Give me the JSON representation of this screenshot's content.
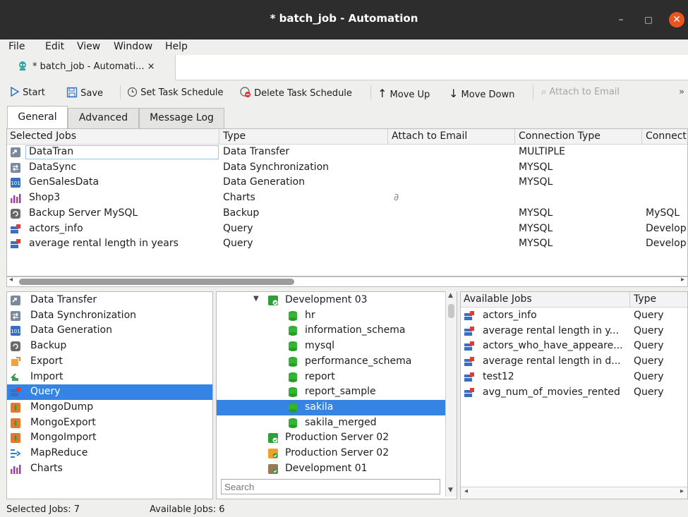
{
  "window": {
    "title": "* batch_job - Automation"
  },
  "menu": [
    "File",
    "Edit",
    "View",
    "Window",
    "Help"
  ],
  "doc_tab": {
    "label": "* batch_job - Automati... ×"
  },
  "toolbar": {
    "start": "Start",
    "save": "Save",
    "set_schedule": "Set Task Schedule",
    "delete_schedule": "Delete Task Schedule",
    "move_up": "Move Up",
    "move_down": "Move Down",
    "attach_email": "Attach to Email",
    "overflow": "»"
  },
  "tabs": [
    "General",
    "Advanced",
    "Message Log"
  ],
  "jobs_table": {
    "headers": [
      "Selected Jobs",
      "Type",
      "Attach to Email",
      "Connection Type",
      "Connecti"
    ],
    "rows": [
      {
        "icon": "data-transfer-icon",
        "name": "DataTran",
        "type": "Data Transfer",
        "attach": "",
        "conn_type": "MULTIPLE",
        "conn": ""
      },
      {
        "icon": "data-sync-icon",
        "name": "DataSync",
        "type": "Data Synchronization",
        "attach": "",
        "conn_type": "MYSQL",
        "conn": ""
      },
      {
        "icon": "data-generation-icon",
        "name": "GenSalesData",
        "type": "Data Generation",
        "attach": "",
        "conn_type": "MYSQL",
        "conn": ""
      },
      {
        "icon": "charts-icon",
        "name": "Shop3",
        "type": "Charts",
        "attach": "paperclip",
        "conn_type": "",
        "conn": ""
      },
      {
        "icon": "backup-icon",
        "name": "Backup Server MySQL",
        "type": "Backup",
        "attach": "",
        "conn_type": "MYSQL",
        "conn": "MySQL"
      },
      {
        "icon": "query-icon",
        "name": "actors_info",
        "type": "Query",
        "attach": "",
        "conn_type": "MYSQL",
        "conn": "Develop"
      },
      {
        "icon": "query-icon",
        "name": "average rental length in years",
        "type": "Query",
        "attach": "",
        "conn_type": "MYSQL",
        "conn": "Develop"
      }
    ]
  },
  "job_types": [
    {
      "label": "Data Transfer",
      "icon": "data-transfer-icon"
    },
    {
      "label": "Data Synchronization",
      "icon": "data-sync-icon"
    },
    {
      "label": "Data Generation",
      "icon": "data-generation-icon"
    },
    {
      "label": "Backup",
      "icon": "backup-icon"
    },
    {
      "label": "Export",
      "icon": "export-icon"
    },
    {
      "label": "Import",
      "icon": "import-icon"
    },
    {
      "label": "Query",
      "icon": "query-icon",
      "selected": true
    },
    {
      "label": "MongoDump",
      "icon": "mongodump-icon"
    },
    {
      "label": "MongoExport",
      "icon": "mongoexport-icon"
    },
    {
      "label": "MongoImport",
      "icon": "mongoimport-icon"
    },
    {
      "label": "MapReduce",
      "icon": "mapreduce-icon"
    },
    {
      "label": "Charts",
      "icon": "charts-icon"
    }
  ],
  "connections_tree": [
    {
      "label": "Development 03",
      "level": 0,
      "kind": "server-green",
      "expanded": true
    },
    {
      "label": "hr",
      "level": 1,
      "kind": "database"
    },
    {
      "label": "information_schema",
      "level": 1,
      "kind": "database"
    },
    {
      "label": "mysql",
      "level": 1,
      "kind": "database"
    },
    {
      "label": "performance_schema",
      "level": 1,
      "kind": "database"
    },
    {
      "label": "report",
      "level": 1,
      "kind": "database"
    },
    {
      "label": "report_sample",
      "level": 1,
      "kind": "database"
    },
    {
      "label": "sakila",
      "level": 1,
      "kind": "database",
      "selected": true
    },
    {
      "label": "sakila_merged",
      "level": 1,
      "kind": "database"
    },
    {
      "label": "Production Server 02",
      "level": 0,
      "kind": "server-green"
    },
    {
      "label": "Production Server 02",
      "level": 0,
      "kind": "server-orange"
    },
    {
      "label": "Development 01",
      "level": 0,
      "kind": "server-brown"
    }
  ],
  "search": {
    "placeholder": "Search"
  },
  "available_jobs": {
    "headers": [
      "Available Jobs",
      "Type"
    ],
    "rows": [
      {
        "name": "actors_info",
        "type": "Query"
      },
      {
        "name": "average rental length in y...",
        "type": "Query"
      },
      {
        "name": "actors_who_have_appeare...",
        "type": "Query"
      },
      {
        "name": "average rental length in d...",
        "type": "Query"
      },
      {
        "name": "test12",
        "type": "Query"
      },
      {
        "name": "avg_num_of_movies_rented",
        "type": "Query"
      }
    ]
  },
  "status": {
    "selected": "Selected Jobs: 7",
    "available": "Available Jobs: 6"
  },
  "colors": {
    "accent": "#3584e4",
    "close": "#e95420",
    "titlebar": "#2d2d2d",
    "db_green": "#33b733"
  }
}
